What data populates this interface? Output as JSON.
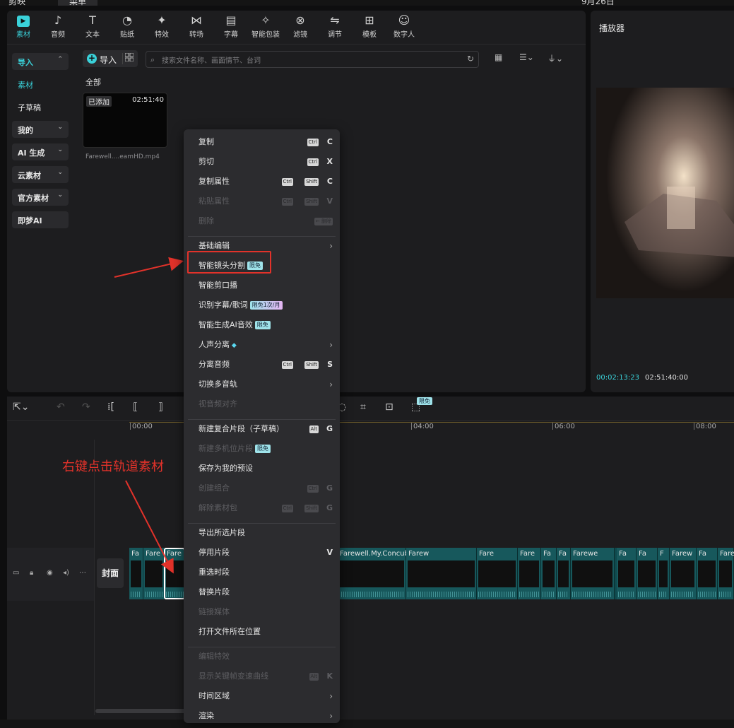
{
  "top": {
    "app_label": "剪映",
    "project_label": "菜单",
    "date_label": "9月26日"
  },
  "toolbar": [
    {
      "label": "素材",
      "icon": "media-icon",
      "active": true
    },
    {
      "label": "音频",
      "icon": "audio-icon"
    },
    {
      "label": "文本",
      "icon": "text-icon"
    },
    {
      "label": "贴纸",
      "icon": "sticker-icon"
    },
    {
      "label": "特效",
      "icon": "effects-icon"
    },
    {
      "label": "转场",
      "icon": "transition-icon"
    },
    {
      "label": "字幕",
      "icon": "caption-icon"
    },
    {
      "label": "智能包装",
      "icon": "smart-pack-icon"
    },
    {
      "label": "滤镜",
      "icon": "filter-icon"
    },
    {
      "label": "调节",
      "icon": "adjust-icon"
    },
    {
      "label": "模板",
      "icon": "template-icon"
    },
    {
      "label": "数字人",
      "icon": "digital-human-icon"
    }
  ],
  "sidenav": [
    {
      "label": "导入",
      "chev": "⌃",
      "selected": true
    },
    {
      "label": "素材",
      "plain": true,
      "selected": true
    },
    {
      "label": "子草稿",
      "plain": true
    },
    {
      "label": "我的",
      "chev": "⌄"
    },
    {
      "label": "AI 生成",
      "chev": "⌄"
    },
    {
      "label": "云素材",
      "chev": "⌄"
    },
    {
      "label": "官方素材",
      "chev": "⌄"
    },
    {
      "label": "即梦AI"
    }
  ],
  "media": {
    "import_label": "导入",
    "search_placeholder": "搜索文件名称、画面情节、台词",
    "all_label": "全部",
    "item": {
      "added": "已添加",
      "duration": "02:51:40",
      "filename": "Farewell....eamHD.mp4"
    }
  },
  "player": {
    "title": "播放器",
    "current_time": "00:02:13:23",
    "total_time": "02:51:40:00"
  },
  "timeline": {
    "ruler": [
      "00:00",
      "04:00",
      "06:00",
      "08:00"
    ],
    "cover_label": "封面",
    "limit_badge": "限免",
    "clips": [
      "Fa",
      "Fare",
      "Fare",
      "Farewell.My.Concub",
      "Farew",
      "Fare",
      "Fare",
      "Fa",
      "Fa",
      "Farewe",
      "Fa",
      "Fa",
      "F",
      "Farew",
      "Fa",
      "Fare"
    ]
  },
  "context_menu": {
    "items": [
      {
        "label": "复制",
        "keys": [
          "Ctrl"
        ],
        "letter": "C"
      },
      {
        "label": "剪切",
        "keys": [
          "Ctrl"
        ],
        "letter": "X"
      },
      {
        "label": "复制属性",
        "keys": [
          "Ctrl",
          "Shift"
        ],
        "letter": "C"
      },
      {
        "label": "粘贴属性",
        "keys": [
          "Ctrl",
          "Shift"
        ],
        "letter": "V",
        "disabled": true
      },
      {
        "label": "删除",
        "keys": [
          "← 删除"
        ],
        "disabled": true
      },
      {
        "sep": true
      },
      {
        "label": "基础编辑",
        "arrow": true
      },
      {
        "label": "智能镜头分割",
        "badge": "限免"
      },
      {
        "label": "智能剪口播"
      },
      {
        "label": "识别字幕/歌词",
        "badge": "限免1次/月",
        "badge_style": "pur"
      },
      {
        "label": "智能生成AI音效",
        "badge": "限免"
      },
      {
        "label": "人声分离",
        "diamond": true,
        "arrow": true
      },
      {
        "label": "分离音频",
        "keys": [
          "Ctrl",
          "Shift"
        ],
        "letter": "S"
      },
      {
        "label": "切换多音轨",
        "arrow": true
      },
      {
        "label": "视音频对齐",
        "disabled": true
      },
      {
        "sep": true
      },
      {
        "label": "新建复合片段（子草稿）",
        "keys": [
          "Alt"
        ],
        "letter": "G"
      },
      {
        "label": "新建多机位片段",
        "badge": "限免",
        "disabled": true
      },
      {
        "label": "保存为我的预设"
      },
      {
        "label": "创建组合",
        "keys": [
          "Ctrl"
        ],
        "letter": "G",
        "disabled": true
      },
      {
        "label": "解除素材包",
        "keys": [
          "Ctrl",
          "Shift"
        ],
        "letter": "G",
        "disabled": true
      },
      {
        "sep": true
      },
      {
        "label": "导出所选片段"
      },
      {
        "label": "停用片段",
        "letter": "V"
      },
      {
        "label": "重选时段"
      },
      {
        "label": "替换片段"
      },
      {
        "label": "链接媒体",
        "disabled": true
      },
      {
        "label": "打开文件所在位置"
      },
      {
        "sep": true
      },
      {
        "label": "编辑特效",
        "disabled": true
      },
      {
        "label": "显示关键帧变速曲线",
        "keys": [
          "Alt"
        ],
        "letter": "K",
        "disabled": true
      },
      {
        "label": "时间区域",
        "arrow": true
      },
      {
        "label": "渲染",
        "arrow": true
      }
    ]
  },
  "annotation": {
    "text": "右键点击轨道素材",
    "color": "#e2322a"
  },
  "colors": {
    "accent": "#3ad1d9",
    "track": "#0f4a4e",
    "highlight": "#e2322a"
  }
}
